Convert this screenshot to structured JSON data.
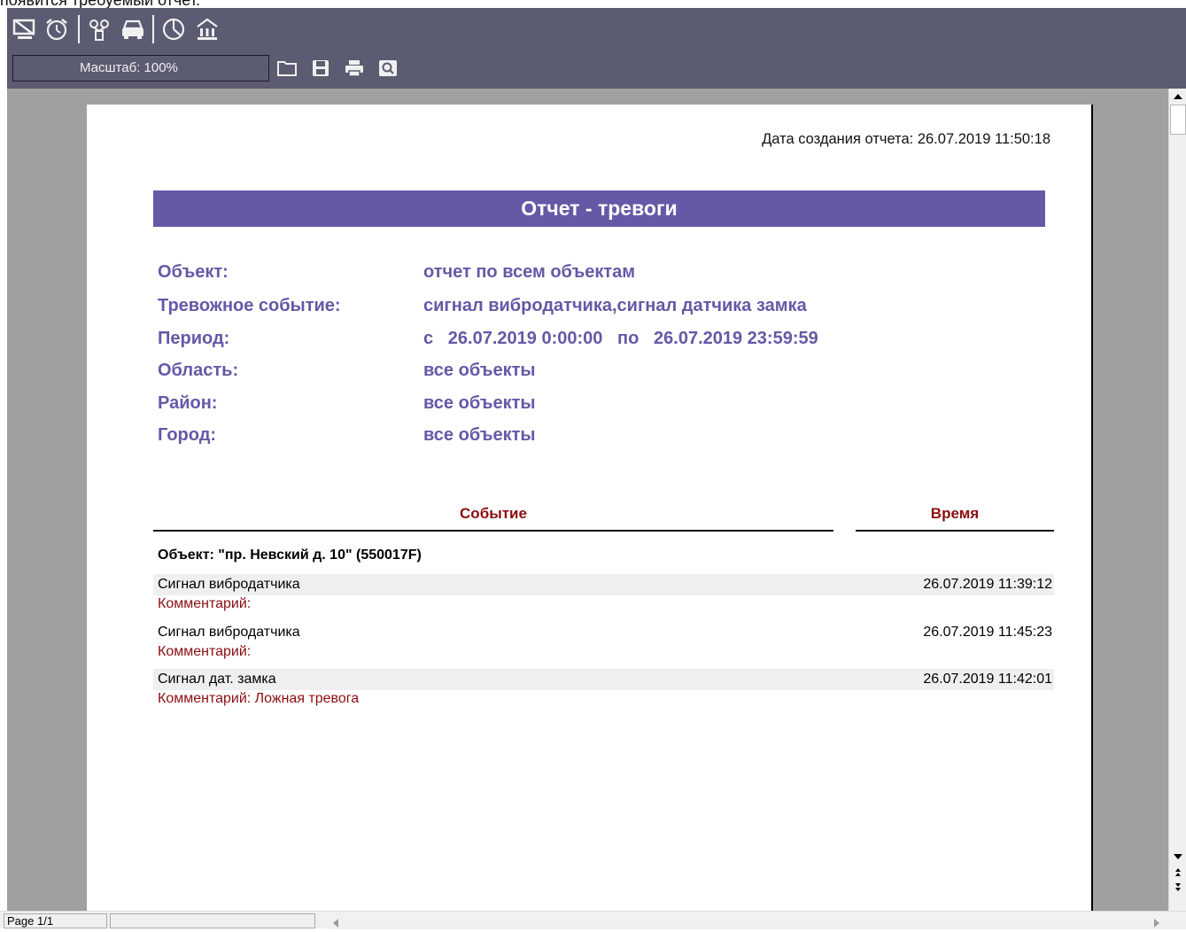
{
  "top_caption": "появится требуемый отчет.",
  "toolbar": {
    "icons": [
      "monitor-icon",
      "alarm-clock-icon",
      "antenna-icon",
      "car-icon",
      "pie-chart-icon",
      "building-icon"
    ],
    "zoom_label": "Масштаб: 100%",
    "file_icons": [
      "folder-icon",
      "save-icon",
      "print-icon",
      "preview-icon"
    ]
  },
  "report": {
    "created": "Дата создания отчета: 26.07.2019 11:50:18",
    "title": "Отчет - тревоги",
    "params": [
      {
        "label": "Объект:",
        "value": "отчет по всем объектам"
      },
      {
        "label": "Тревожное событие:",
        "value": "сигнал вибродатчика,сигнал датчика замка"
      },
      {
        "label": "Период:",
        "value": "с   26.07.2019 0:00:00   по   26.07.2019 23:59:59"
      },
      {
        "label": "Область:",
        "value": "все объекты"
      },
      {
        "label": "Район:",
        "value": "все объекты"
      },
      {
        "label": "Город:",
        "value": "все объекты"
      }
    ],
    "columns": {
      "event": "Событие",
      "time": "Время"
    },
    "object_title": "Объект: \"пр. Невский д. 10\" (550017F)",
    "events": [
      {
        "name": "Сигнал вибродатчика",
        "time": "26.07.2019 11:39:12",
        "comment": "Комментарий:"
      },
      {
        "name": "Сигнал вибродатчика",
        "time": "26.07.2019 11:45:23",
        "comment": "Комментарий:"
      },
      {
        "name": "Сигнал дат. замка",
        "time": "26.07.2019 11:42:01",
        "comment": "Комментарий: Ложная тревога"
      }
    ]
  },
  "statusbar": {
    "page": "Page 1/1"
  },
  "colors": {
    "toolbar_bg": "#5b5b72",
    "accent": "#6559a7",
    "column_header": "#8b0e10",
    "viewport_bg": "#a0a0a0"
  }
}
